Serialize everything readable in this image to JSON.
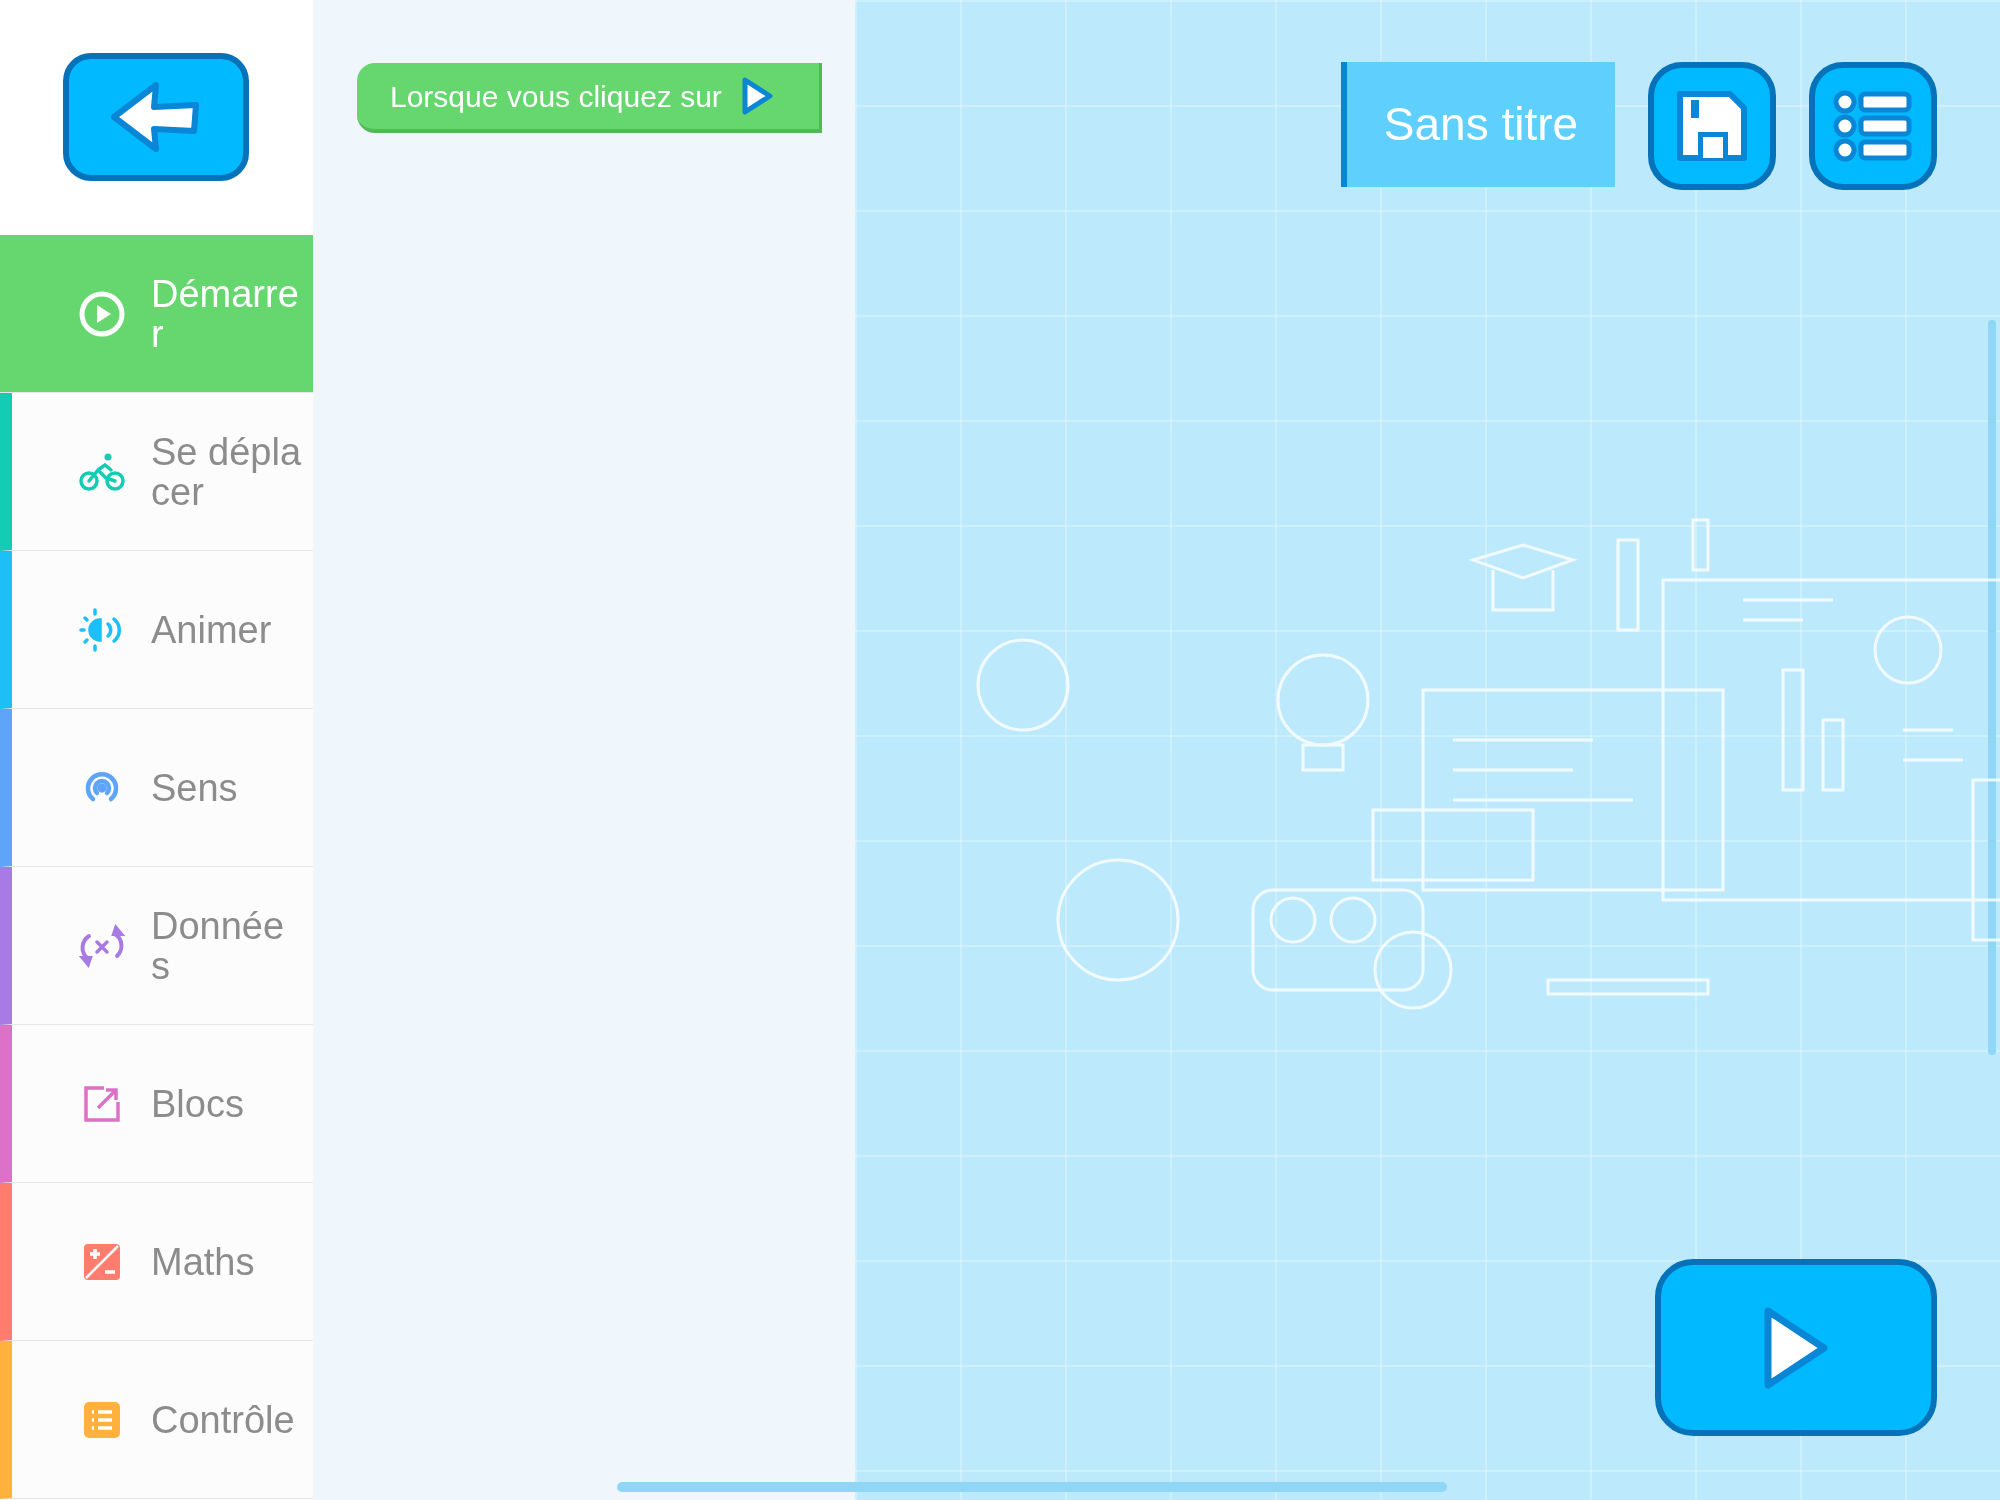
{
  "block": {
    "label": "Lorsque vous cliquez sur"
  },
  "categories": [
    {
      "label": "Démarrer",
      "kind": "start",
      "color": "#66d66e",
      "selected": true
    },
    {
      "label": "Se déplacer",
      "kind": "move",
      "color": "#14ccb4",
      "selected": false
    },
    {
      "label": "Animer",
      "kind": "animate",
      "color": "#1ebef6",
      "selected": false
    },
    {
      "label": "Sens",
      "kind": "sense",
      "color": "#5ea4f8",
      "selected": false
    },
    {
      "label": "Données",
      "kind": "data",
      "color": "#a87be4",
      "selected": false
    },
    {
      "label": "Blocs",
      "kind": "blocks",
      "color": "#dc72c8",
      "selected": false
    },
    {
      "label": "Maths",
      "kind": "maths",
      "color": "#fe7d6e",
      "selected": false
    },
    {
      "label": "Contrôle",
      "kind": "control",
      "color": "#feb13c",
      "selected": false
    }
  ],
  "project": {
    "title": "Sans titre"
  }
}
